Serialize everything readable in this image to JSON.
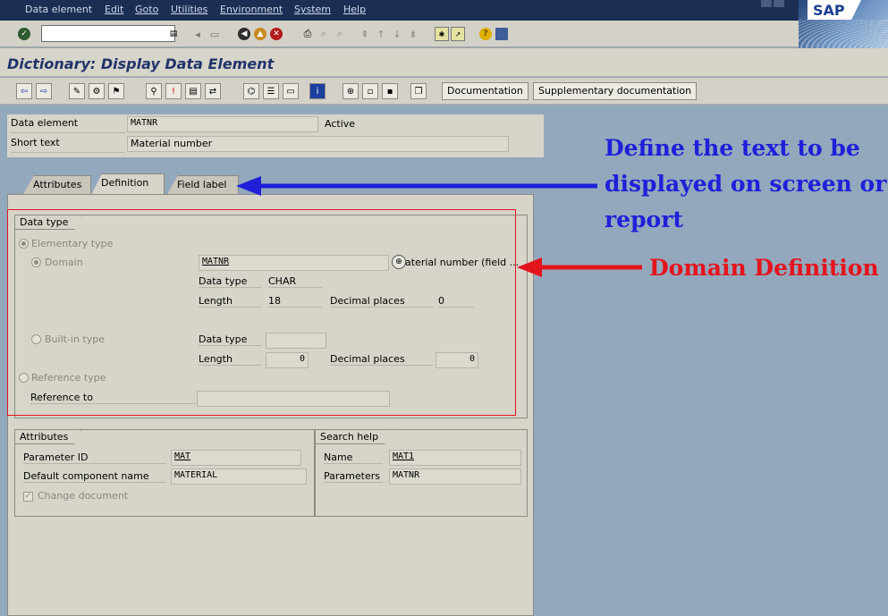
{
  "menu": {
    "items": [
      "Data element",
      "Edit",
      "Goto",
      "Utilities",
      "Environment",
      "System",
      "Help"
    ]
  },
  "brand": {
    "logo_text": "SAP"
  },
  "system_toolbar": {
    "command_field_value": ""
  },
  "title": "Dictionary: Display Data Element",
  "app_toolbar": {
    "documentation_label": "Documentation",
    "supplementary_label": "Supplementary documentation"
  },
  "header": {
    "data_element_label": "Data element",
    "data_element_value": "MATNR",
    "status": "Active",
    "short_text_label": "Short text",
    "short_text_value": "Material number"
  },
  "tabs": [
    {
      "label": "Attributes"
    },
    {
      "label": "Definition"
    },
    {
      "label": "Field label"
    }
  ],
  "data_type_group": {
    "title": "Data type",
    "elementary_type_label": "Elementary type",
    "domain_label": "Domain",
    "domain_value": "MATNR",
    "domain_description": "aterial number (field ...",
    "data_type_label": "Data type",
    "data_type_value": "CHAR",
    "length_label": "Length",
    "length_value": "18",
    "decimal_places_label": "Decimal places",
    "decimal_places_value": "0",
    "builtin_type_label": "Built-in type",
    "builtin_data_type_label": "Data type",
    "builtin_length_label": "Length",
    "builtin_length_value": "0",
    "builtin_decimal_label": "Decimal places",
    "builtin_decimal_value": "0",
    "reference_type_label": "Reference type",
    "reference_to_label": "Reference to"
  },
  "attributes_group": {
    "title": "Attributes",
    "parameter_id_label": "Parameter ID",
    "parameter_id_value": "MAT",
    "default_component_label": "Default component name",
    "default_component_value": "MATERIAL",
    "change_document_label": "Change document"
  },
  "search_help_group": {
    "title": "Search help",
    "name_label": "Name",
    "name_value": "MAT1",
    "parameters_label": "Parameters",
    "parameters_value": "MATNR"
  },
  "annotations": {
    "field_label_note_line1": "Define the text to be",
    "field_label_note_line2": "displayed on screen or",
    "field_label_note_line3": "report",
    "domain_note": "Domain Definition",
    "blue_color": "#1f20d8",
    "red_color": "#e4141d"
  }
}
